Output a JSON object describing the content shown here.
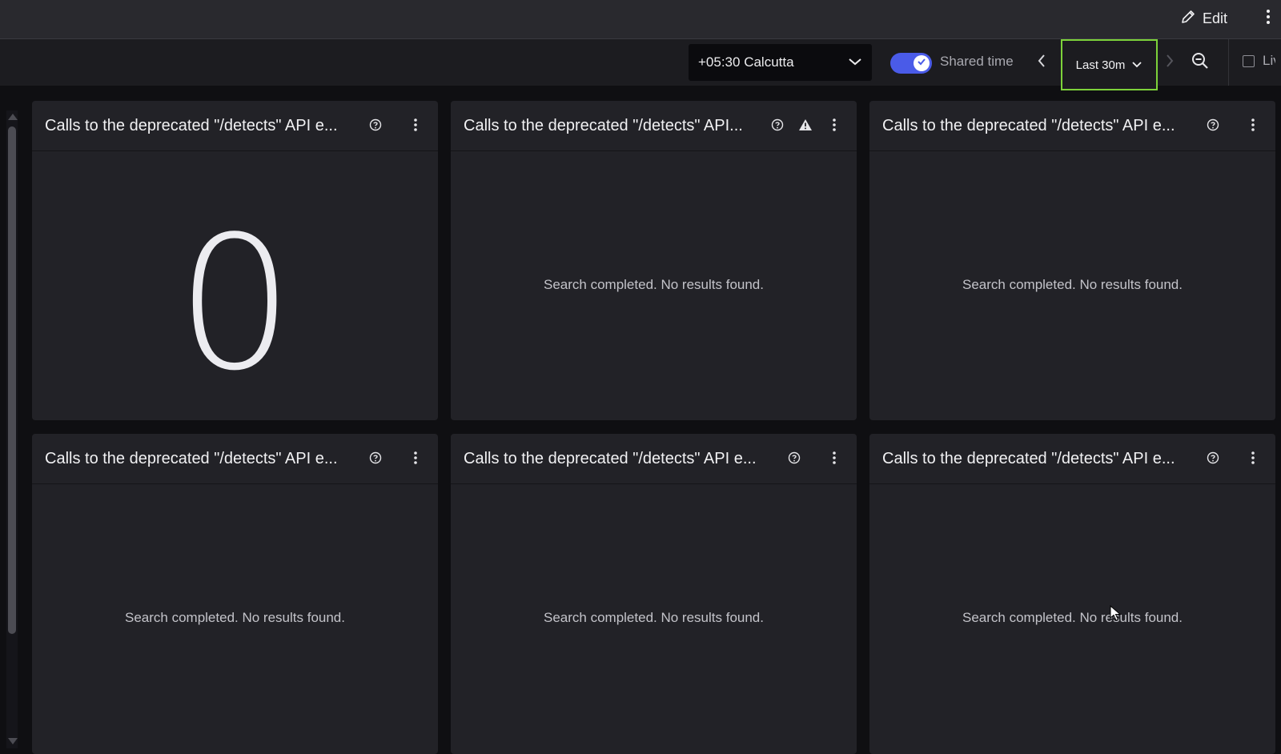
{
  "topbar": {
    "edit_label": "Edit",
    "edit_icon": "pencil-icon",
    "more_icon": "kebab-icon"
  },
  "toolbar": {
    "timezone": "+05:30 Calcutta",
    "shared_time_label": "Shared time",
    "shared_time_enabled": true,
    "time_range": "Last 30m",
    "live_label": "Live",
    "live_checked": false
  },
  "colors": {
    "toggle": "#4a5be8",
    "range_highlight": "#7dd23a",
    "panel": "#222227",
    "topbar": "#29292e"
  },
  "widgets": [
    {
      "title": "Calls to the deprecated \"/detects\" API e...",
      "value": "0",
      "empty_text": "",
      "warning": false
    },
    {
      "title": "Calls to the deprecated \"/detects\" API...",
      "value": "",
      "empty_text": "Search completed. No results found.",
      "warning": true
    },
    {
      "title": "Calls to the deprecated \"/detects\" API e...",
      "value": "",
      "empty_text": "Search completed. No results found.",
      "warning": false
    },
    {
      "title": "Calls to the deprecated \"/detects\" API e...",
      "value": "",
      "empty_text": "Search completed. No results found.",
      "warning": false
    },
    {
      "title": "Calls to the deprecated \"/detects\" API e...",
      "value": "",
      "empty_text": "Search completed. No results found.",
      "warning": false
    },
    {
      "title": "Calls to the deprecated \"/detects\" API e...",
      "value": "",
      "empty_text": "Search completed. No results found.",
      "warning": false
    }
  ]
}
